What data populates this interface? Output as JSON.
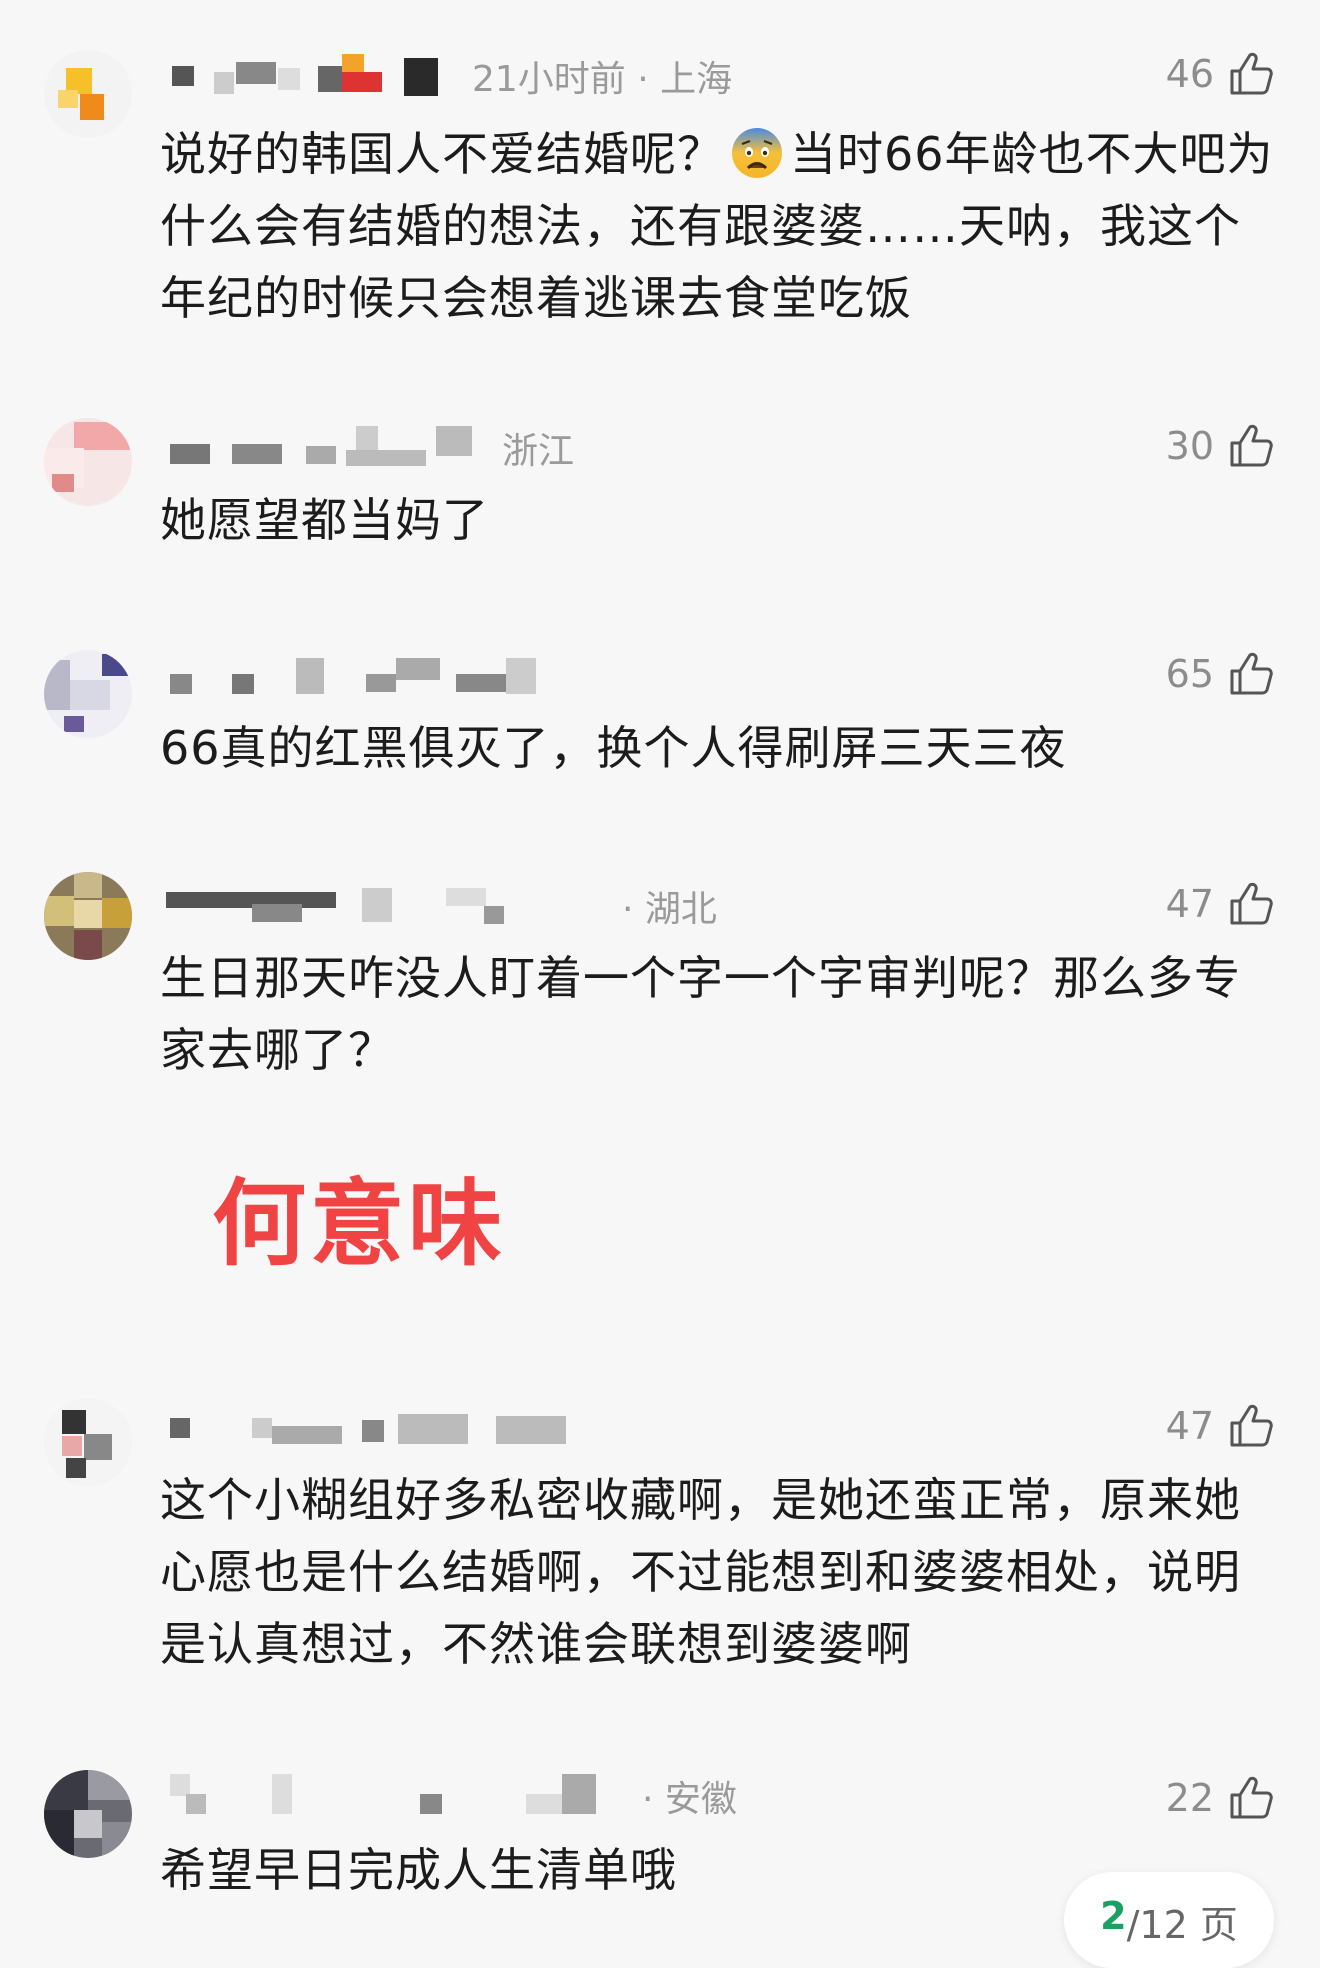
{
  "comments": [
    {
      "time_location": "21小时前 · 上海",
      "likes": "46",
      "text_before_emoji": "说好的韩国人不爱结婚呢？",
      "emoji": "fearful-face",
      "text_after_emoji": "当时66年龄也不大吧为什么会有结婚的想法，还有跟婆婆……天呐，我这个年纪的时候只会想着逃课去食堂吃饭"
    },
    {
      "time_location": "浙江",
      "likes": "30",
      "text": "她愿望都当妈了"
    },
    {
      "time_location": "",
      "likes": "65",
      "text": "66真的红黑俱灭了，换个人得刷屏三天三夜"
    },
    {
      "time_location": "· 湖北",
      "likes": "47",
      "text": "生日那天咋没人盯着一个字一个字审判呢？那么多专家去哪了？"
    },
    {
      "time_location": "",
      "likes": "47",
      "text": "这个小糊组好多私密收藏啊，是她还蛮正常，原来她心愿也是什么结婚啊，不过能想到和婆婆相处，说明是认真想过，不然谁会联想到婆婆啊"
    },
    {
      "time_location": "· 安徽",
      "likes": "22",
      "text": "希望早日完成人生清单哦"
    }
  ],
  "overlay_caption": "何意味",
  "pagination": {
    "current": "2",
    "total": "/12 页"
  },
  "colors": {
    "accent_green": "#1aa060",
    "overlay_red": "#f04444"
  },
  "icons": {
    "like": "thumb-up-icon",
    "emoji": "fearful-face-icon"
  }
}
